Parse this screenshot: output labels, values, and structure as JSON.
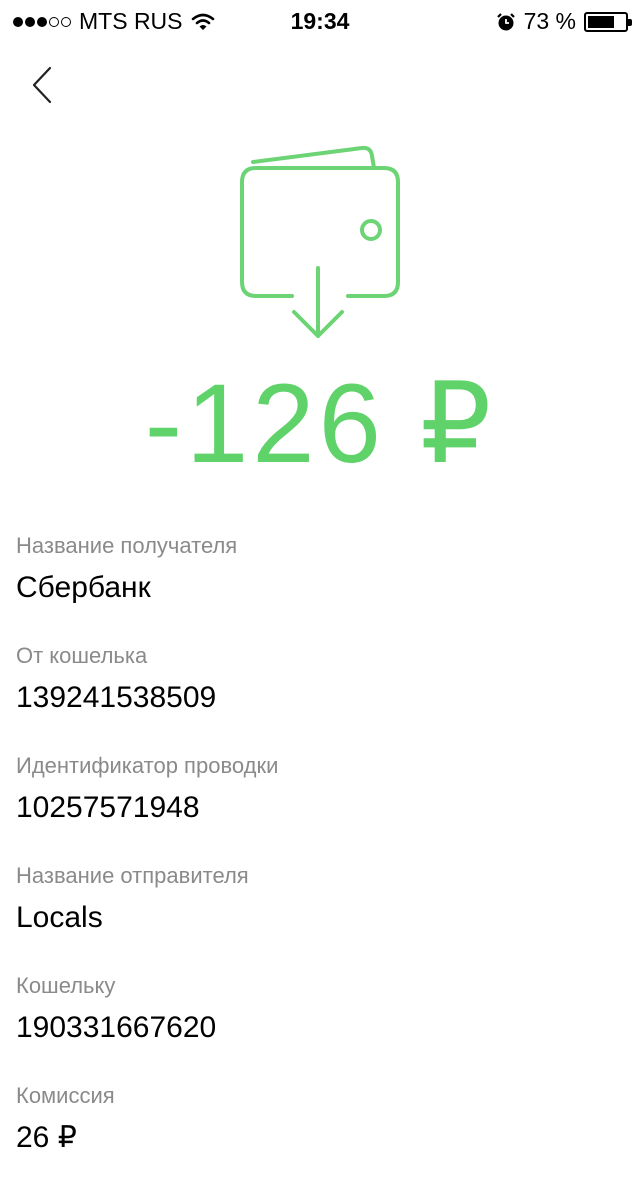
{
  "status_bar": {
    "carrier": "MTS RUS",
    "time": "19:34",
    "battery": "73 %",
    "battery_level": 0.73
  },
  "transaction": {
    "amount": "-126 ₽",
    "accent_color": "#5fd36a"
  },
  "fields": [
    {
      "label": "Название получателя",
      "value": "Сбербанк"
    },
    {
      "label": "От кошелька",
      "value": "139241538509"
    },
    {
      "label": "Идентификатор проводки",
      "value": "10257571948"
    },
    {
      "label": "Название отправителя",
      "value": "Locals"
    },
    {
      "label": "Кошельку",
      "value": "190331667620"
    },
    {
      "label": "Комиссия",
      "value": "26 ₽"
    }
  ]
}
